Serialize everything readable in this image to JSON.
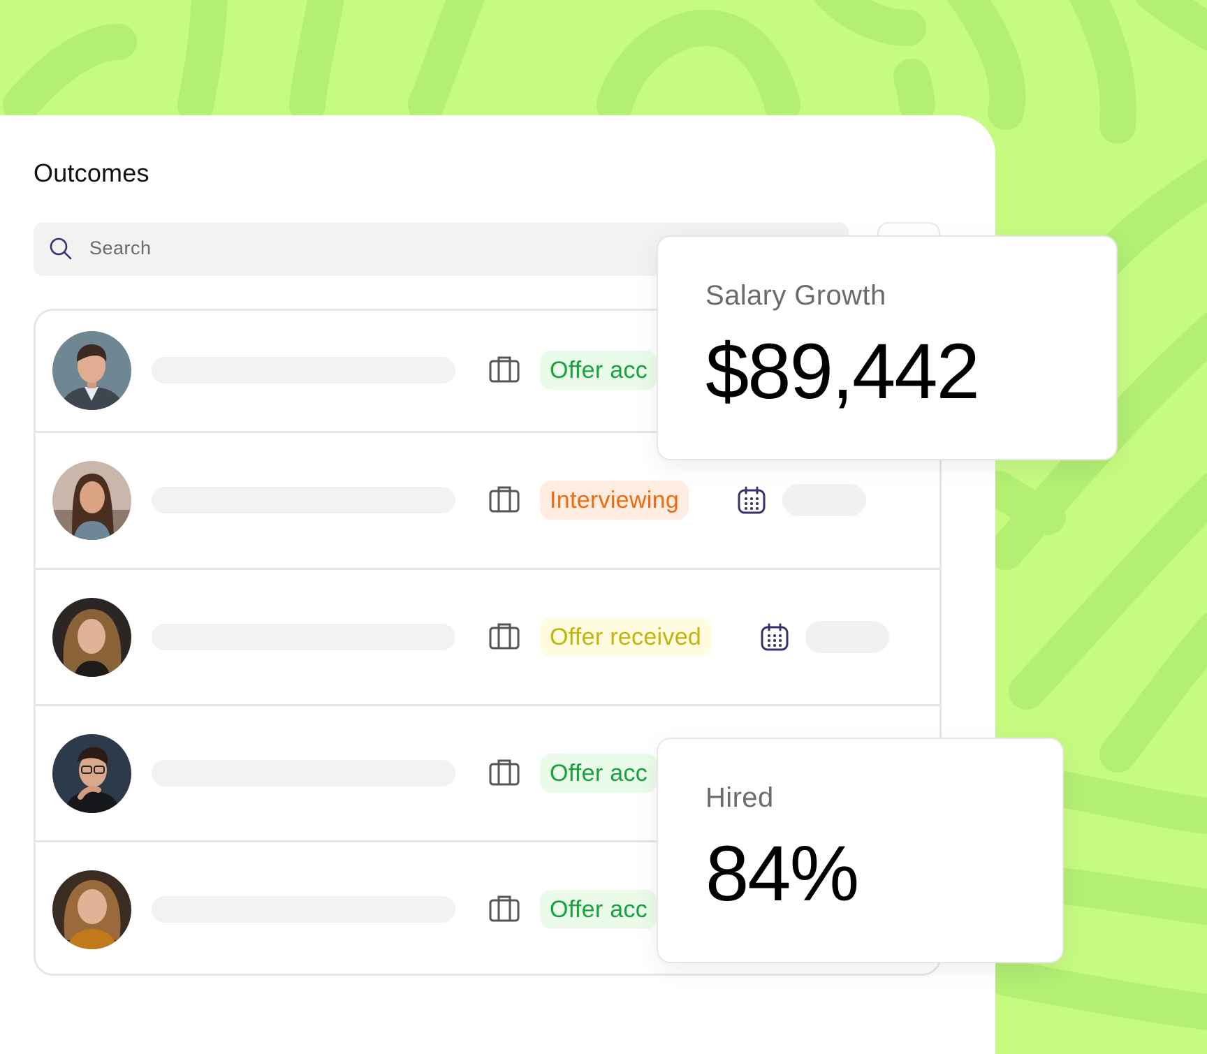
{
  "page": {
    "background_color": "#c6fb82"
  },
  "panel": {
    "title": "Outcomes",
    "search": {
      "placeholder": "Search",
      "icon": "search-icon"
    }
  },
  "rows": [
    {
      "status": "Offer acc",
      "status_kind": "green",
      "has_date": false
    },
    {
      "status": "Interviewing",
      "status_kind": "orange",
      "has_date": true
    },
    {
      "status": "Offer received",
      "status_kind": "yellow",
      "has_date": true
    },
    {
      "status": "Offer acc",
      "status_kind": "green",
      "has_date": false
    },
    {
      "status": "Offer acc",
      "status_kind": "green",
      "has_date": false
    }
  ],
  "stats": {
    "salary": {
      "label": "Salary Growth",
      "value": "$89,442"
    },
    "hired": {
      "label": "Hired",
      "value": "84%"
    }
  },
  "colors": {
    "accent_green": "#17a13e",
    "accent_orange": "#f06a10",
    "accent_yellow": "#c1b40a",
    "calendar_icon": "#3b2f6e"
  }
}
